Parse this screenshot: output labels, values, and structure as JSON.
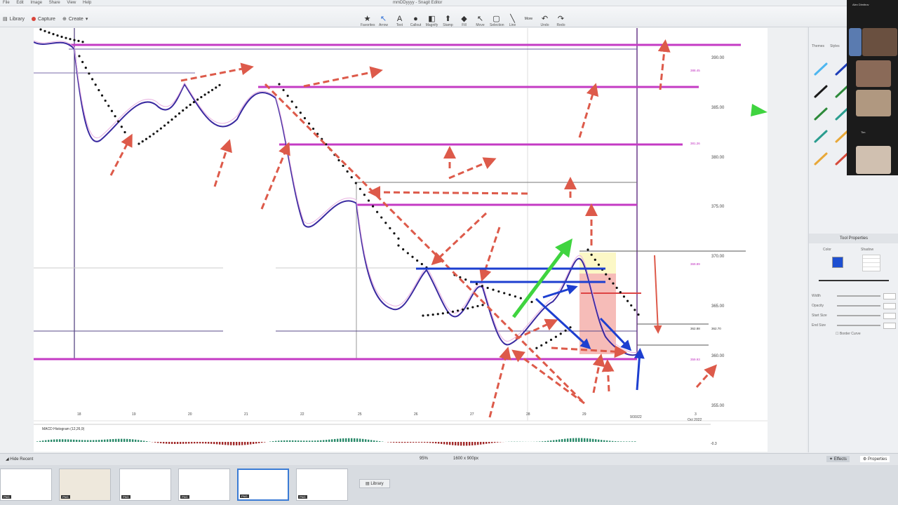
{
  "menu": [
    "File",
    "Edit",
    "Image",
    "Share",
    "View",
    "Help"
  ],
  "window_title": "mmDDyyyy - Snagit Editor",
  "toolbar_left": {
    "library": "Library",
    "capture": "Capture",
    "create": "Create"
  },
  "tools": [
    {
      "icon": "star-icon",
      "glyph": "★",
      "label": "Favorites"
    },
    {
      "icon": "arrow-icon",
      "glyph": "↖",
      "label": "Arrow"
    },
    {
      "icon": "text-icon",
      "glyph": "A",
      "label": "Text"
    },
    {
      "icon": "callout-icon",
      "glyph": "●",
      "label": "Callout"
    },
    {
      "icon": "magnify-icon",
      "glyph": "◧",
      "label": "Magnify"
    },
    {
      "icon": "stamp-icon",
      "glyph": "⬆",
      "label": "Stamp"
    },
    {
      "icon": "fill-icon",
      "glyph": "◆",
      "label": "Fill"
    },
    {
      "icon": "move-icon",
      "glyph": "↖",
      "label": "Move"
    },
    {
      "icon": "selection-icon",
      "glyph": "▢",
      "label": "Selection"
    },
    {
      "icon": "line-icon",
      "glyph": "╲",
      "label": "Line"
    },
    {
      "icon": "more-icon",
      "glyph": "More",
      "label": ""
    },
    {
      "icon": "undo-icon",
      "glyph": "↶",
      "label": "Undo"
    },
    {
      "icon": "redo-icon",
      "glyph": "↷",
      "label": "Redo"
    }
  ],
  "price_axis": [
    "390.00",
    "385.00",
    "380.00",
    "375.00",
    "370.00",
    "365.00",
    "360.00",
    "355.00"
  ],
  "small_price_tags": [
    {
      "text": "388.45",
      "color": "#c030c0"
    },
    {
      "text": "381.26",
      "color": "#c030c0"
    },
    {
      "text": "369.89",
      "color": "#c030c0"
    },
    {
      "text": "362.88",
      "color": "#333333"
    },
    {
      "text": "362.70",
      "color": "#333333"
    },
    {
      "text": "359.93",
      "color": "#c030c0"
    }
  ],
  "date_axis": [
    "18",
    "19",
    "20",
    "21",
    "22",
    "25",
    "26",
    "27",
    "28",
    "29",
    "9/30/22",
    "3",
    "Oct 2022"
  ],
  "indicator_label": "MACD Histogram (12,26,9)",
  "indicator_value": "-0.3",
  "right_panel": {
    "tab1": "Themes",
    "tab2": "Styles",
    "tool_props_title": "Tool Properties",
    "fill_label": "Color",
    "shadow_label": "Shadow",
    "rows": [
      "Width",
      "Opacity",
      "Start Size",
      "End Size"
    ],
    "border_label": "Border Curve",
    "pen_colors": [
      "#4db6f0",
      "#1a1a1a",
      "#2d8a3a",
      "#2a9d8f",
      "#e8a838",
      "#1f3fb8",
      "#2d8a3a",
      "#2a9d8f",
      "#e8a838",
      "#d64a3a"
    ],
    "selected_color": "#1d4fd1"
  },
  "participants": [
    "Alex Dimitrov",
    "Mattias",
    "Tim"
  ],
  "statusbar": {
    "hide_recent": "Hide Recent",
    "zoom": "95%",
    "dims": "1600 x 900px",
    "effects": "Effects",
    "properties": "Properties"
  },
  "thumb_tags": [
    "PNG",
    "PNG",
    "PNG",
    "PNG",
    "PNG",
    "PNG"
  ],
  "thumb_library": "Library"
}
